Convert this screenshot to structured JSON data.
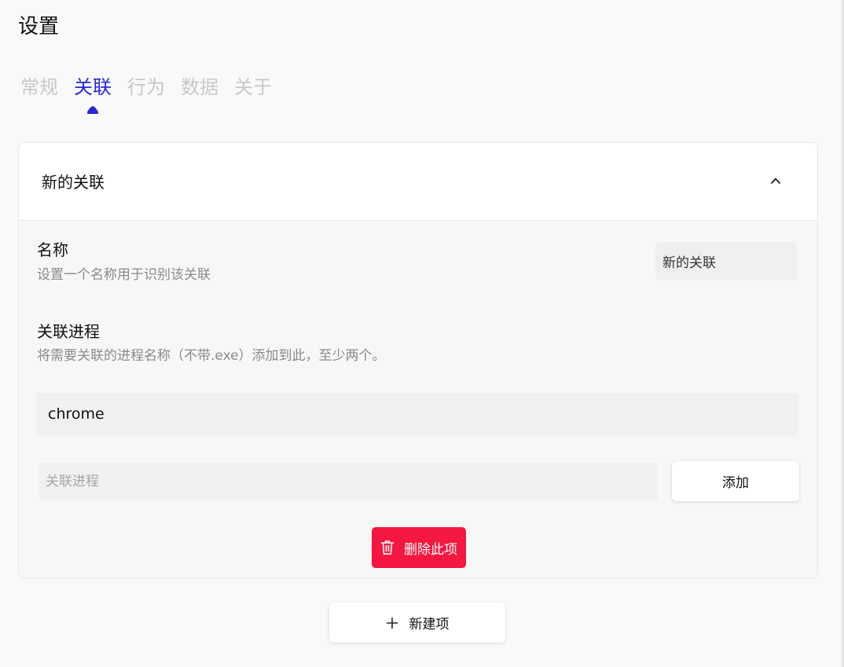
{
  "header": {
    "title": "设置"
  },
  "tabs": [
    {
      "label": "常规",
      "active": false
    },
    {
      "label": "关联",
      "active": true
    },
    {
      "label": "行为",
      "active": false
    },
    {
      "label": "数据",
      "active": false
    },
    {
      "label": "关于",
      "active": false
    }
  ],
  "association": {
    "title": "新的关联",
    "name_field": {
      "label": "名称",
      "description": "设置一个名称用于识别该关联",
      "value": "新的关联"
    },
    "process_field": {
      "label": "关联进程",
      "description": "将需要关联的进程名称（不带.exe）添加到此，至少两个。",
      "items": [
        "chrome"
      ],
      "input_placeholder": "关联进程",
      "add_label": "添加"
    },
    "delete_label": "删除此项"
  },
  "new_item_label": "新建项",
  "colors": {
    "accent": "#2727d8",
    "danger": "#f5173f",
    "tab_inactive": "#c8c8c8"
  }
}
